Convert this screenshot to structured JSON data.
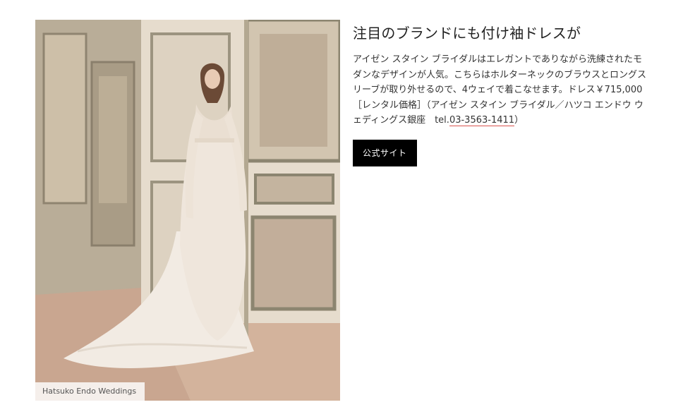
{
  "article": {
    "heading": "注目のブランドにも付け袖ドレスが",
    "body_before_link": "アイゼン スタイン ブライダルはエレガントでありながら洗練されたモダンなデザインが人気。こちらはホルターネックのブラウスとロングスリーブが取り外せるので、4ウェイで着こなせます。ドレス￥715,000［レンタル価格］（アイゼン スタイン ブライダル／ハツコ エンドウ ウェディングス銀座　tel.",
    "tel_link": "03-3563-1411",
    "body_after_link": "）",
    "button_label": "公式サイト"
  },
  "photo": {
    "credit": "Hatsuko Endo Weddings"
  },
  "colors": {
    "button_bg": "#000000",
    "link_underline": "#d9534f"
  }
}
